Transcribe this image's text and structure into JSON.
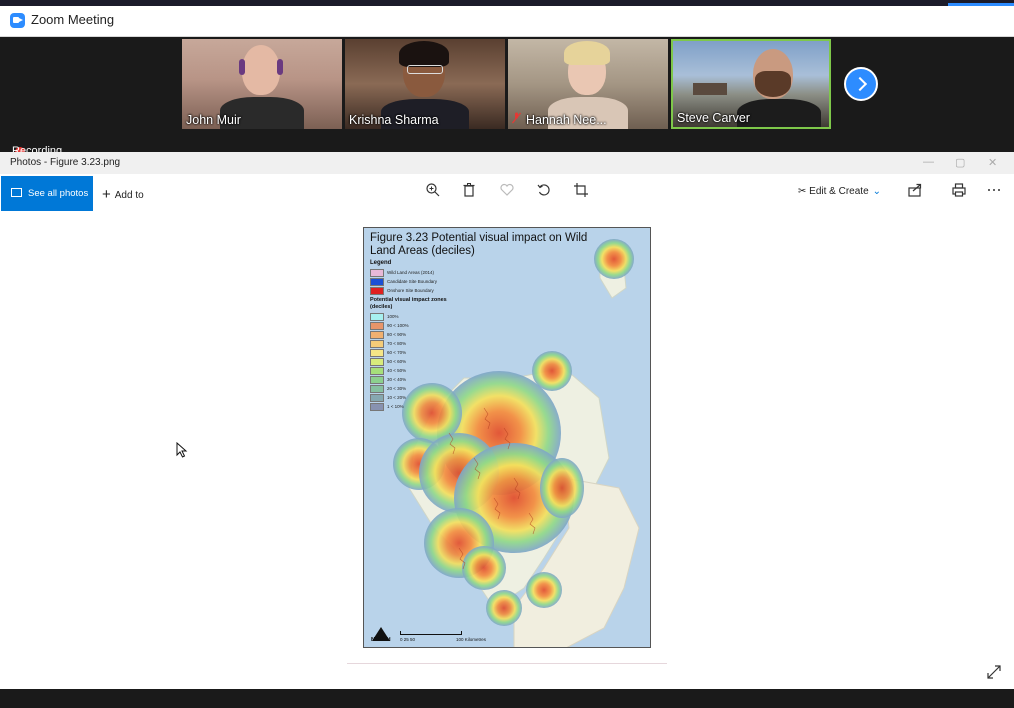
{
  "zoom": {
    "window_title": "Zoom Meeting",
    "recording_label": "Recording",
    "participants": [
      {
        "name": "John Muir",
        "muted": false
      },
      {
        "name": "Krishna Sharma",
        "muted": false
      },
      {
        "name": "Hannah Nee...",
        "muted": true
      },
      {
        "name": "Steve Carver",
        "muted": false,
        "active_speaker": true
      }
    ],
    "accent_color": "#2d8cff",
    "active_speaker_color": "#7ec84a"
  },
  "photos": {
    "window_title": "Photos - Figure 3.23.png",
    "toolbar": {
      "see_all_label": "See all photos",
      "add_to_label": "Add to",
      "edit_create_label": "Edit & Create",
      "icons": [
        "zoom-in-icon",
        "delete-icon",
        "favorite-heart-icon",
        "rotate-icon",
        "crop-icon",
        "share-icon",
        "print-icon",
        "more-icon"
      ]
    },
    "accent_color": "#0078d7"
  },
  "figure": {
    "title": "Figure 3.23 Potential visual impact on Wild Land Areas (deciles)",
    "legend_heading": "Legend",
    "legend_items": [
      {
        "label": "Wild Land Areas (2014)",
        "color": "#e8b8d8"
      },
      {
        "label": "Candidate Site Boundary",
        "color": "#1a4fd6"
      },
      {
        "label": "Onshore Site Boundary",
        "color": "#e02020"
      }
    ],
    "zones_heading": "Potential visual impact zones",
    "zones_subheading": "(deciles)",
    "zones": [
      {
        "label": "100%",
        "color": "#a7f0f0"
      },
      {
        "label": "90 < 100%",
        "color": "#e8956a"
      },
      {
        "label": "80 < 90%",
        "color": "#f0b070"
      },
      {
        "label": "70 < 80%",
        "color": "#f5cc78"
      },
      {
        "label": "60 < 70%",
        "color": "#f5e686"
      },
      {
        "label": "50 < 60%",
        "color": "#d8ec7c"
      },
      {
        "label": "40 < 50%",
        "color": "#a6e07a"
      },
      {
        "label": "30 < 40%",
        "color": "#8cd08e"
      },
      {
        "label": "20 < 30%",
        "color": "#86c0a0"
      },
      {
        "label": "10 < 20%",
        "color": "#86a8b0"
      },
      {
        "label": "1 < 10%",
        "color": "#8892b0"
      }
    ],
    "north_label": "NORTH",
    "scale_ticks": "0    25    50",
    "scale_label": "100 Kilometres"
  }
}
